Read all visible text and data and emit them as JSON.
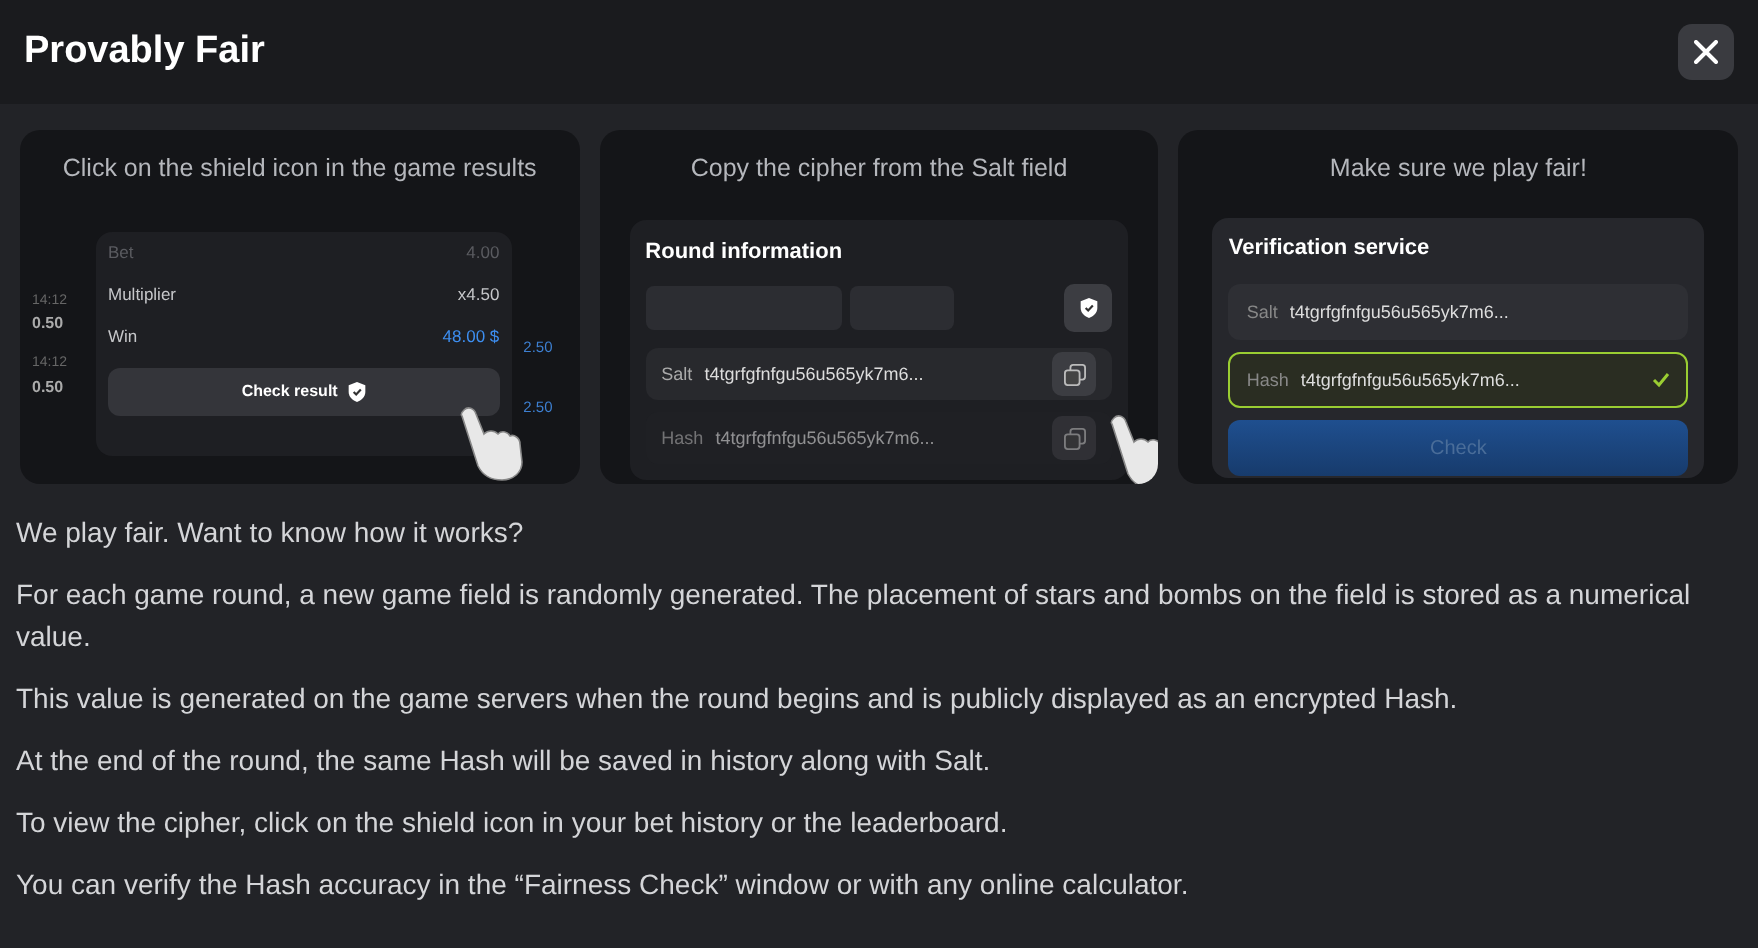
{
  "title": "Provably Fair",
  "steps": [
    {
      "kind": "result",
      "caption": "Click on the shield icon in the game results",
      "rows": [
        {
          "label": "Bet",
          "value": "4.00",
          "dim": true,
          "highlight": false
        },
        {
          "label": "Multiplier",
          "value": "x4.50",
          "dim": false,
          "highlight": false
        },
        {
          "label": "Win",
          "value": "48.00 $",
          "dim": false,
          "highlight": true
        }
      ],
      "history": [
        {
          "time": "14:12",
          "amount": "0.50",
          "payout": "2.50"
        },
        {
          "time": "14:12",
          "amount": "0.50",
          "payout": "2.50"
        }
      ],
      "button": "Check result"
    },
    {
      "kind": "round",
      "caption": "Copy the cipher from the Salt field",
      "title": "Round information",
      "fields": [
        {
          "label": "Salt",
          "value": "t4tgrfgfnfgu56u565yk7m6...",
          "dim": false
        },
        {
          "label": "Hash",
          "value": "t4tgrfgfnfgu56u565yk7m6...",
          "dim": true
        }
      ]
    },
    {
      "kind": "verify",
      "caption": "Make sure we play fair!",
      "title": "Verification service",
      "fields": [
        {
          "label": "Salt",
          "value": "t4tgrfgfnfgu56u565yk7m6...",
          "valid": false
        },
        {
          "label": "Hash",
          "value": "t4tgrfgfnfgu56u565yk7m6...",
          "valid": true
        }
      ],
      "button": "Check"
    }
  ],
  "paragraphs": [
    "We play fair. Want to know how it works?",
    "For each game round, a new game field is randomly generated. The placement of stars and bombs on the field is stored as a numerical value.",
    "This value is generated on the game servers when the round begins and is publicly displayed as an encrypted Hash.",
    "At the end of the round, the same Hash will be saved in history along with Salt.",
    "To view the cipher, click on the shield icon in your bet history or the leaderboard.",
    "You can verify the Hash accuracy in the “Fairness Check” window or with any online calculator."
  ]
}
